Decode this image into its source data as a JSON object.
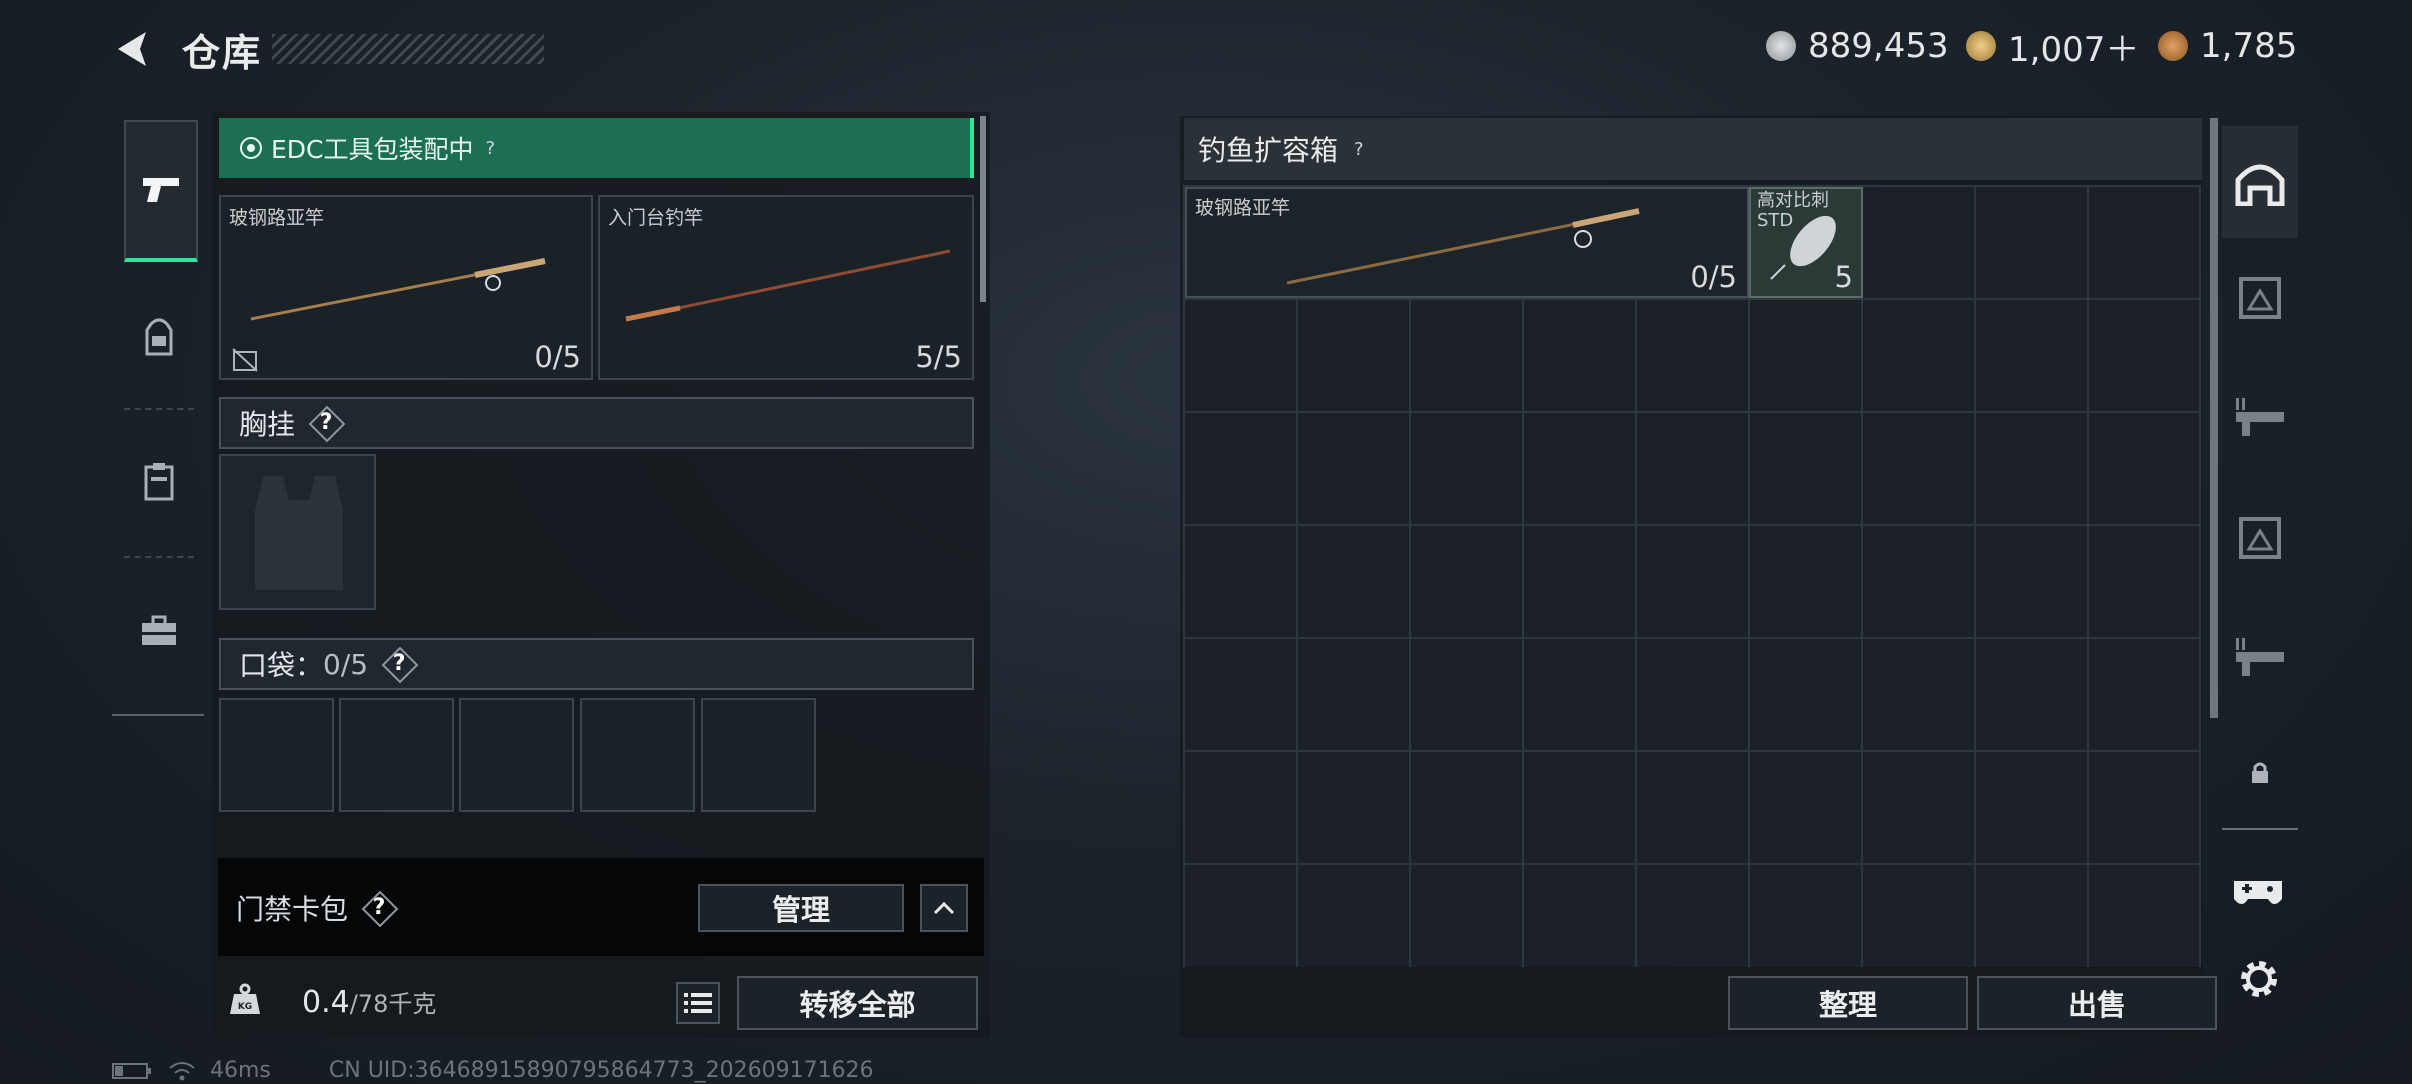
{
  "header": {
    "back_icon": "chevron-left-icon",
    "title": "仓库",
    "currencies": [
      {
        "icon": "silver-coin-icon",
        "value": "889,453",
        "color": "#b9bec2"
      },
      {
        "icon": "gold-coin-icon",
        "value": "1,007＋",
        "color": "#c9a25a"
      },
      {
        "icon": "bronze-coin-icon",
        "value": "1,785",
        "color": "#b9793c"
      }
    ]
  },
  "left_tabs": [
    "pistol-icon",
    "backpack-icon",
    "clipboard-icon",
    "toolbox-icon"
  ],
  "loadout": {
    "banner": "EDC工具包装配中",
    "banner_help": "?",
    "rods": [
      {
        "name": "玻钢路亚竿",
        "count": "0/5"
      },
      {
        "name": "入门台钓竿",
        "count": "5/5"
      }
    ],
    "chest_rig": {
      "title": "胸挂",
      "help": "?"
    },
    "pockets": {
      "title": "口袋：",
      "count": "0/5",
      "help": "?"
    },
    "keycard": {
      "title": "门禁卡包",
      "help": "?",
      "manage": "管理",
      "collapse_icon": "chevron-up-icon"
    },
    "weight": {
      "current": "0.4",
      "max": "/78千克",
      "icon": "kg-weight-icon"
    },
    "list_icon": "list-icon",
    "transfer_all": "转移全部"
  },
  "storage": {
    "title": "钓鱼扩容箱",
    "help": "?",
    "items": [
      {
        "name": "玻钢路亚竿",
        "count": "0/5"
      },
      {
        "name": "高对比刺\nSTD",
        "count": "5"
      }
    ],
    "sort_button": "整理",
    "sell_button": "出售"
  },
  "right_tabs": [
    "home-icon",
    "container-icon",
    "weapon-rack-icon",
    "container-icon",
    "weapon-rack-icon",
    "lock-icon"
  ],
  "bottom_right_icons": [
    "gamepad-icon",
    "gear-icon"
  ],
  "status": {
    "ping": "46ms",
    "uid": "CN UID:36468915890795864773_202609171626"
  }
}
